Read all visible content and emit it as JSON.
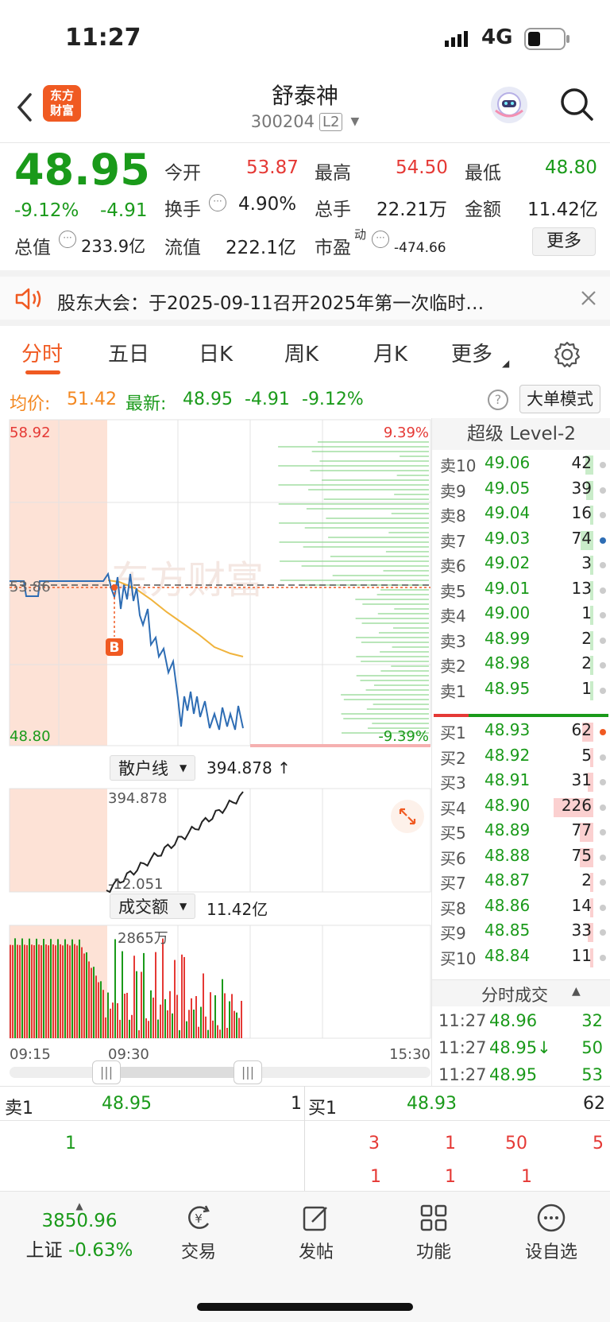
{
  "status": {
    "time": "11:27",
    "network": "4G"
  },
  "header": {
    "logo_line1": "东方",
    "logo_line2": "财富",
    "title": "舒泰神",
    "code": "300204",
    "level_badge": "L2"
  },
  "quote": {
    "price": "48.95",
    "change_pct": "-9.12%",
    "change": "-4.91",
    "open_label": "今开",
    "open": "53.87",
    "high_label": "最高",
    "high": "54.50",
    "low_label": "最低",
    "low": "48.80",
    "turnover_label": "换手",
    "turnover": "4.90%",
    "volume_label": "总手",
    "volume": "22.21万",
    "amount_label": "金额",
    "amount": "11.42亿",
    "mktcap_label": "总值",
    "mktcap": "233.9亿",
    "float_label": "流值",
    "float": "222.1亿",
    "pe_label": "市盈",
    "pe_sup": "动",
    "pe": "-474.66",
    "more_button": "更多"
  },
  "notice": {
    "text": "股东大会：于2025-09-11召开2025年第一次临时…"
  },
  "tabs": [
    {
      "label": "分时"
    },
    {
      "label": "五日"
    },
    {
      "label": "日K"
    },
    {
      "label": "周K"
    },
    {
      "label": "月K"
    },
    {
      "label": "更多"
    }
  ],
  "info": {
    "avg_label": "均价:",
    "avg": "51.42",
    "last_label": "最新:",
    "last": "48.95",
    "chg": "-4.91",
    "pct": "-9.12%",
    "big_order_button": "大单模式"
  },
  "chart": {
    "y_top": "58.92",
    "y_mid": "53.86",
    "y_bottom": "48.80",
    "pct_top": "9.39%",
    "pct_bottom": "-9.39%",
    "buy_marker": "B",
    "retail_selector": "散户线",
    "retail_value": "394.878 ↑",
    "retail_top": "394.878",
    "retail_bottom": "-12.051",
    "amount_selector": "成交额",
    "amount_value": "11.42亿",
    "amount_top": "2865万",
    "time_start": "09:15",
    "time_mid": "09:30",
    "time_end": "15:30",
    "watermark": "东方财富"
  },
  "orderbook": {
    "title": "超级 Level-2",
    "asks": [
      {
        "n": "卖10",
        "p": "49.06",
        "q": "42",
        "w": 0.12
      },
      {
        "n": "卖9",
        "p": "49.05",
        "q": "39",
        "w": 0.11
      },
      {
        "n": "卖8",
        "p": "49.04",
        "q": "16",
        "w": 0.05
      },
      {
        "n": "卖7",
        "p": "49.03",
        "q": "74",
        "w": 0.2
      },
      {
        "n": "卖6",
        "p": "49.02",
        "q": "3",
        "w": 0.02
      },
      {
        "n": "卖5",
        "p": "49.01",
        "q": "13",
        "w": 0.04
      },
      {
        "n": "卖4",
        "p": "49.00",
        "q": "1",
        "w": 0.01
      },
      {
        "n": "卖3",
        "p": "48.99",
        "q": "2",
        "w": 0.01
      },
      {
        "n": "卖2",
        "p": "48.98",
        "q": "2",
        "w": 0.01
      },
      {
        "n": "卖1",
        "p": "48.95",
        "q": "1",
        "w": 0.01
      }
    ],
    "bids": [
      {
        "n": "买1",
        "p": "48.93",
        "q": "62",
        "w": 0.17
      },
      {
        "n": "买2",
        "p": "48.92",
        "q": "5",
        "w": 0.02
      },
      {
        "n": "买3",
        "p": "48.91",
        "q": "31",
        "w": 0.09
      },
      {
        "n": "买4",
        "p": "48.90",
        "q": "226",
        "w": 0.62
      },
      {
        "n": "买5",
        "p": "48.89",
        "q": "77",
        "w": 0.21
      },
      {
        "n": "买6",
        "p": "48.88",
        "q": "75",
        "w": 0.21
      },
      {
        "n": "买7",
        "p": "48.87",
        "q": "2",
        "w": 0.01
      },
      {
        "n": "买8",
        "p": "48.86",
        "q": "14",
        "w": 0.04
      },
      {
        "n": "买9",
        "p": "48.85",
        "q": "33",
        "w": 0.09
      },
      {
        "n": "买10",
        "p": "48.84",
        "q": "11",
        "w": 0.03
      }
    ],
    "ticks_title": "分时成交",
    "ticks": [
      {
        "t": "11:27",
        "p": "48.96",
        "v": "32"
      },
      {
        "t": "11:27",
        "p": "48.95↓",
        "v": "50"
      },
      {
        "t": "11:27",
        "p": "48.95",
        "v": "53"
      }
    ]
  },
  "book": {
    "sell_label": "卖1",
    "sell_price": "48.95",
    "sell_qty": "1",
    "buy_label": "买1",
    "buy_price": "48.93",
    "buy_qty": "62",
    "sell_queue": [
      "1"
    ],
    "buy_queue_row1": [
      "3",
      "1",
      "50",
      "5"
    ],
    "buy_queue_row2": [
      "1",
      "1",
      "1"
    ]
  },
  "nav": {
    "index_value": "3850.96",
    "index_name": "上证",
    "index_pct": "-0.63%",
    "trade": "交易",
    "post": "发帖",
    "func": "功能",
    "watch": "设自选"
  }
}
